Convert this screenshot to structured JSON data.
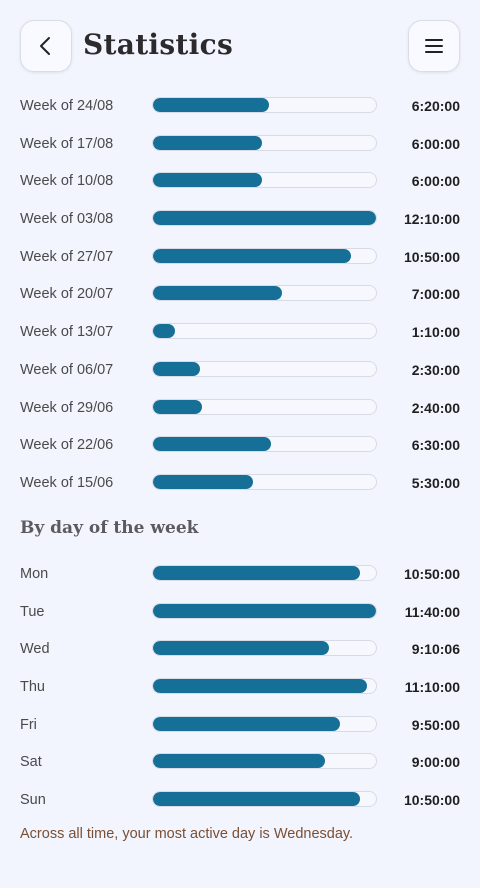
{
  "header": {
    "title": "Statistics",
    "back_icon": "chevron-left-icon",
    "menu_icon": "hamburger-menu-icon"
  },
  "colors": {
    "bar_fill": "#166f96",
    "background": "#f2f5fe",
    "footnote": "#7a4f33"
  },
  "weekly": [
    {
      "label": "Week of 24/08",
      "value": "6:20:00",
      "fraction": 0.52
    },
    {
      "label": "Week of 17/08",
      "value": "6:00:00",
      "fraction": 0.49
    },
    {
      "label": "Week of 10/08",
      "value": "6:00:00",
      "fraction": 0.49
    },
    {
      "label": "Week of 03/08",
      "value": "12:10:00",
      "fraction": 1.0
    },
    {
      "label": "Week of 27/07",
      "value": "10:50:00",
      "fraction": 0.89
    },
    {
      "label": "Week of 20/07",
      "value": "7:00:00",
      "fraction": 0.58
    },
    {
      "label": "Week of 13/07",
      "value": "1:10:00",
      "fraction": 0.1
    },
    {
      "label": "Week of 06/07",
      "value": "2:30:00",
      "fraction": 0.21
    },
    {
      "label": "Week of 29/06",
      "value": "2:40:00",
      "fraction": 0.22
    },
    {
      "label": "Week of 22/06",
      "value": "6:30:00",
      "fraction": 0.53
    },
    {
      "label": "Week of 15/06",
      "value": "5:30:00",
      "fraction": 0.45
    }
  ],
  "by_day": {
    "title": "By day of the week",
    "days": [
      {
        "label": "Mon",
        "value": "10:50:00",
        "fraction": 0.93
      },
      {
        "label": "Tue",
        "value": "11:40:00",
        "fraction": 1.0
      },
      {
        "label": "Wed",
        "value": "9:10:06",
        "fraction": 0.79
      },
      {
        "label": "Thu",
        "value": "11:10:00",
        "fraction": 0.96
      },
      {
        "label": "Fri",
        "value": "9:50:00",
        "fraction": 0.84
      },
      {
        "label": "Sat",
        "value": "9:00:00",
        "fraction": 0.77
      },
      {
        "label": "Sun",
        "value": "10:50:00",
        "fraction": 0.93
      }
    ],
    "footnote": "Across all time, your most active day is Wednesday."
  }
}
